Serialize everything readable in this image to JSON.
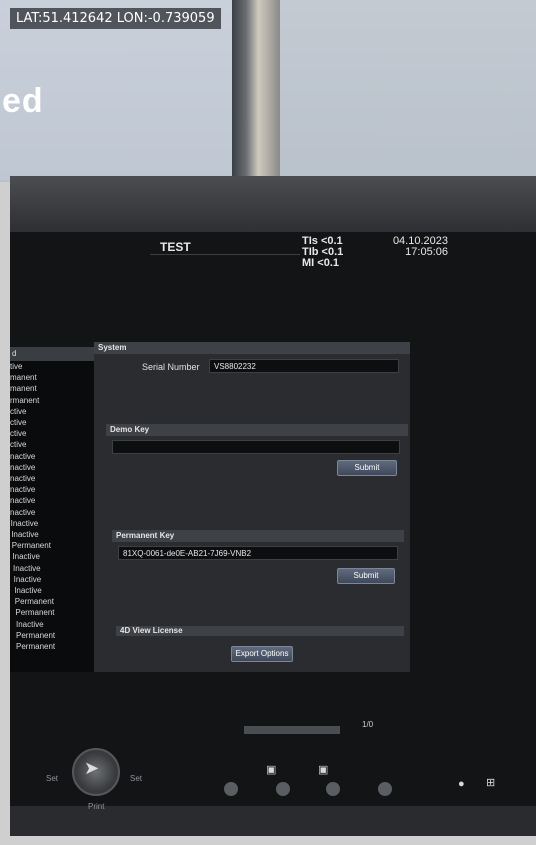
{
  "photo": {
    "geotag": "LAT:51.412642 LON:-0.739059",
    "banner_text": "ed"
  },
  "header": {
    "title": "TEST",
    "tis": "TIs <0.1",
    "tib": "TIb <0.1",
    "mi": "MI <0.1",
    "date": "04.10.2023",
    "time": "17:05:06"
  },
  "left_list": {
    "head": "d",
    "items": [
      "tive",
      "manent",
      "manent",
      "rmanent",
      "ctive",
      "ctive",
      "ctive",
      "ctive",
      "nactive",
      "nactive",
      "nactive",
      "nactive",
      "nactive",
      "nactive",
      "Inactive",
      "Inactive",
      "Permanent",
      "Inactive",
      "Inactive",
      "Inactive",
      "Inactive",
      "Permanent",
      "Permanent",
      "Inactive",
      "Permanent",
      "Permanent"
    ]
  },
  "system": {
    "section_label": "System",
    "serial_label": "Serial Number",
    "serial_value": "VS8802232"
  },
  "demo_key": {
    "section_label": "Demo Key",
    "value": "",
    "submit_label": "Submit"
  },
  "permanent_key": {
    "section_label": "Permanent Key",
    "value": "81XQ-0061-de0E-AB21-7J69-VNB2",
    "submit_label": "Submit"
  },
  "view_license": {
    "section_label": "4D View License",
    "export_label": "Export Options"
  },
  "footer": {
    "page_count": "1/0",
    "set_left": "Set",
    "set_right": "Set",
    "print_label": "Print"
  },
  "colors": {
    "panel_bg": "#2a2c2f",
    "section_head": "#3e4146",
    "button": "#4b5568"
  }
}
